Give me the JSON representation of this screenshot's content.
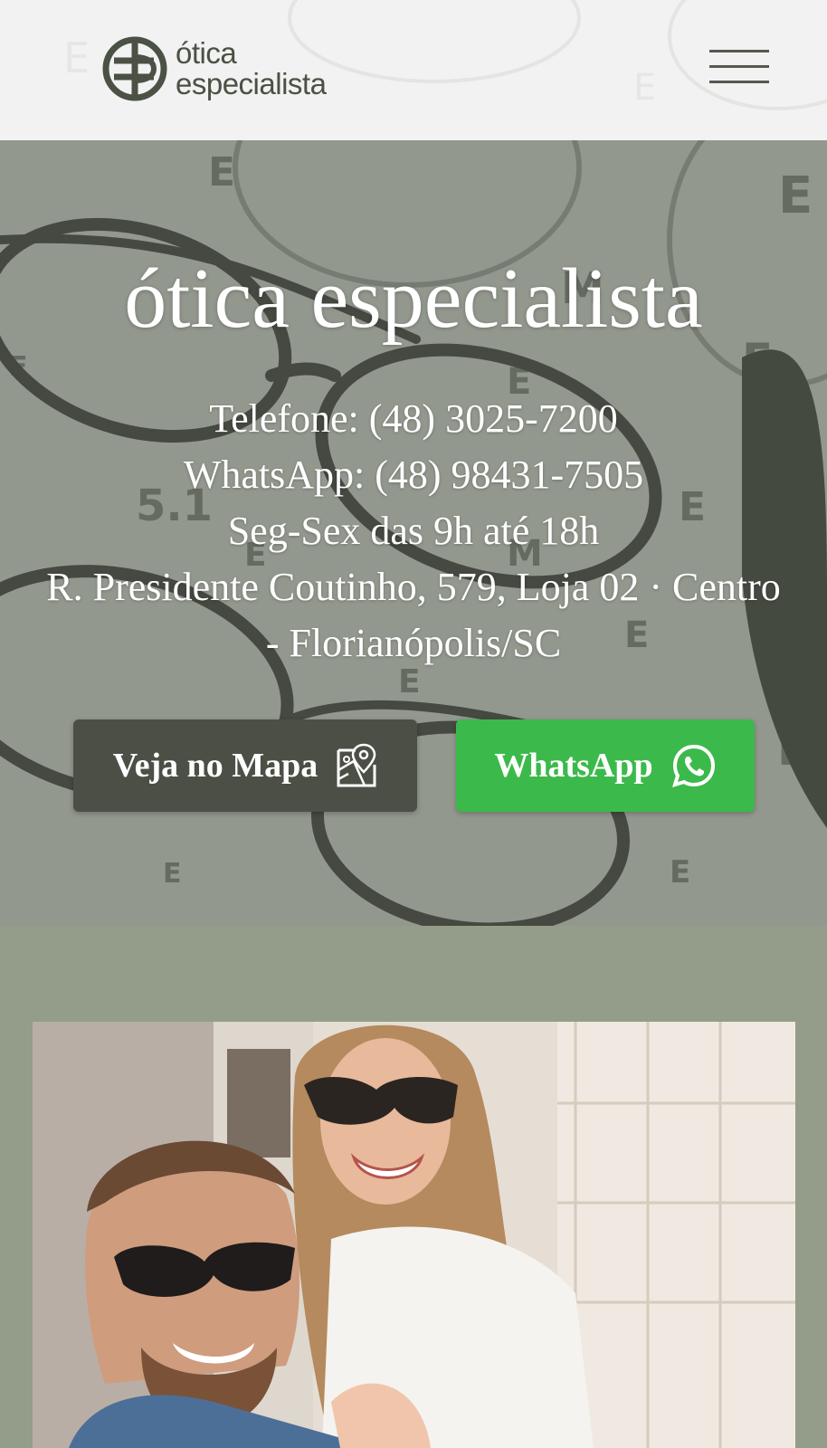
{
  "header": {
    "logo": {
      "line1": "ótica",
      "line2": "especialista"
    },
    "menu_icon": "hamburger-menu-icon"
  },
  "hero": {
    "title": "ótica especialista",
    "phone": "Telefone: (48) 3025-7200",
    "whatsapp": "WhatsApp: (48) 98431-7505",
    "hours": "Seg-Sex das 9h até 18h",
    "address_line1": "R. Presidente Coutinho, 579, Loja 02 · Centro",
    "address_line2": "- Florianópolis/SC",
    "buttons": {
      "map_label": "Veja no Mapa",
      "map_icon": "map-pin-icon",
      "whatsapp_label": "WhatsApp",
      "whatsapp_icon": "whatsapp-icon"
    }
  },
  "photo_section": {
    "image": "couple-in-sunglasses-photo"
  },
  "colors": {
    "header_bg": "#f1f2f1",
    "logo": "#4b5144",
    "hero_overlay": "#585e52",
    "map_button": "#4c4f45",
    "whatsapp_button": "#3cb94b",
    "section_bg": "#939d89"
  }
}
